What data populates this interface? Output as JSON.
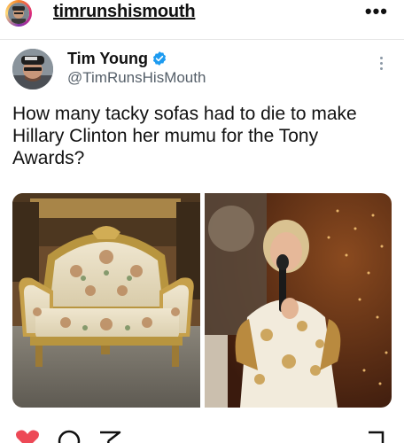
{
  "instagram": {
    "username": "timrunshismouth",
    "more_label": "•••"
  },
  "tweet": {
    "display_name": "Tim Young",
    "handle": "@TimRunsHisMouth",
    "text": "How many tacky sofas had to die to make Hillary Clinton her mumu for the Tony Awards?",
    "images": [
      "ornate-gold-floral-sofa",
      "hillary-clinton-floral-outfit-at-podium"
    ]
  },
  "actions": [
    "heart-icon",
    "comment-icon",
    "share-icon",
    "bookmark-icon"
  ],
  "colors": {
    "verified": "#1d9bf0",
    "heart": "#ed4956",
    "handle": "#555f69"
  }
}
